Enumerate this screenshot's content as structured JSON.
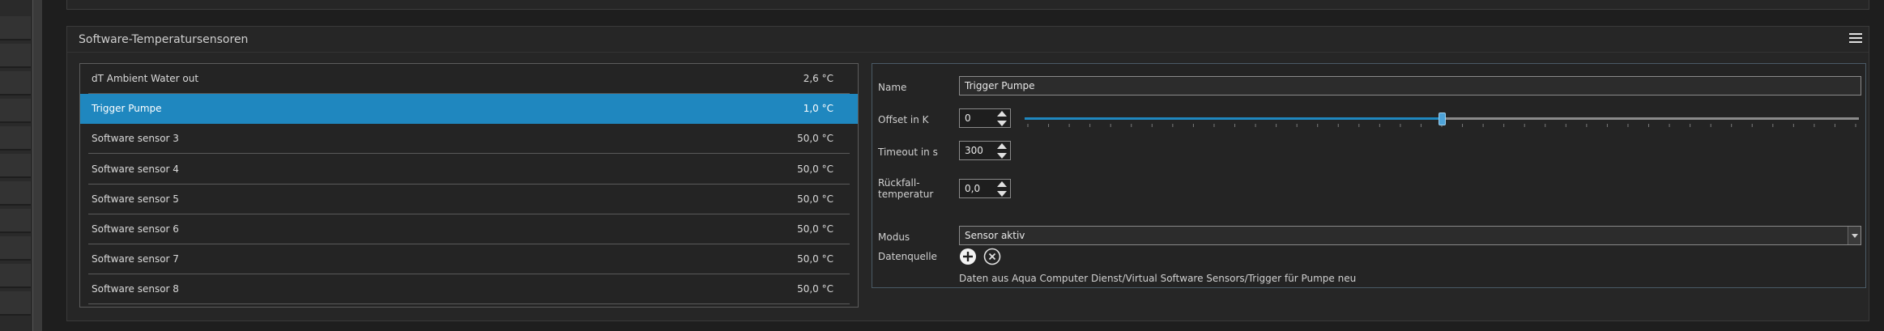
{
  "panel": {
    "title": "Software-Temperatursensoren",
    "menu_icon": "hamburger-menu-icon"
  },
  "sensors": [
    {
      "name": "dT Ambient Water out",
      "value": "2,6 °C",
      "selected": false
    },
    {
      "name": "Trigger Pumpe",
      "value": "1,0 °C",
      "selected": true
    },
    {
      "name": "Software sensor 3",
      "value": "50,0 °C",
      "selected": false
    },
    {
      "name": "Software sensor 4",
      "value": "50,0 °C",
      "selected": false
    },
    {
      "name": "Software sensor 5",
      "value": "50,0 °C",
      "selected": false
    },
    {
      "name": "Software sensor 6",
      "value": "50,0 °C",
      "selected": false
    },
    {
      "name": "Software sensor 7",
      "value": "50,0 °C",
      "selected": false
    },
    {
      "name": "Software sensor 8",
      "value": "50,0 °C",
      "selected": false
    }
  ],
  "detail": {
    "name_label": "Name",
    "name_value": "Trigger Pumpe",
    "offset_label": "Offset in K",
    "offset_value": "0",
    "offset_slider_fraction": 0.5,
    "timeout_label": "Timeout in s",
    "timeout_value": "300",
    "fallback_label_line1": "Rückfall-",
    "fallback_label_line2": "temperatur",
    "fallback_value": "0,0",
    "mode_label": "Modus",
    "mode_value": "Sensor aktiv",
    "source_label": "Datenquelle",
    "add_icon": "plus-circle-icon",
    "remove_icon": "close-circle-icon",
    "source_path": "Daten aus Aqua Computer Dienst/Virtual Software Sensors/Trigger für Pumpe neu"
  },
  "colors": {
    "accent": "#1f87bf",
    "panel_bg": "#262626",
    "border": "#8a8a8a"
  }
}
